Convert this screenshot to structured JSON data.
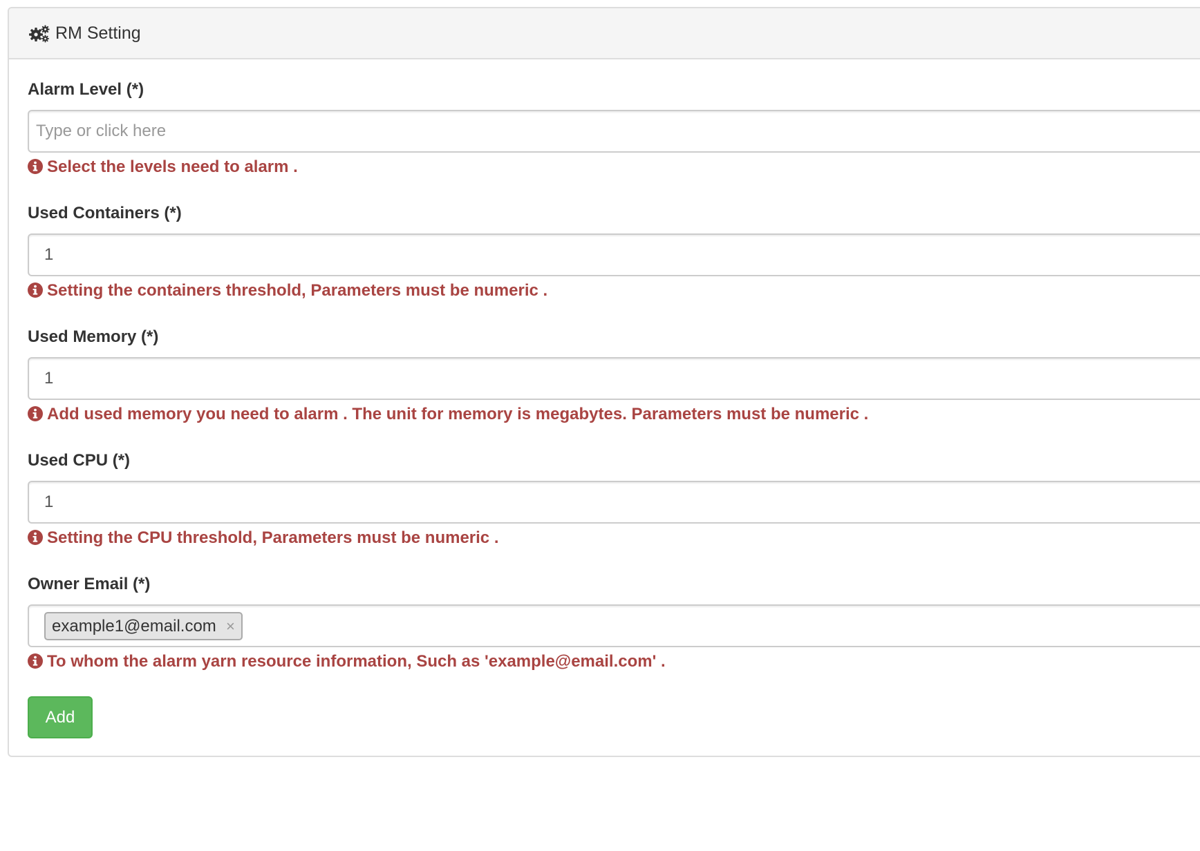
{
  "panel": {
    "title": "RM Setting",
    "icon": "gears-icon"
  },
  "fields": {
    "alarm_level": {
      "label": "Alarm Level (*)",
      "value": "",
      "placeholder": "Type or click here",
      "help": "Select the levels need to alarm ."
    },
    "used_containers": {
      "label": "Used Containers (*)",
      "value": "1",
      "placeholder": "",
      "help": "Setting the containers threshold, Parameters must be numeric ."
    },
    "used_memory": {
      "label": "Used Memory (*)",
      "value": "1",
      "placeholder": "",
      "help": "Add used memory you need to alarm . The unit for memory is megabytes. Parameters must be numeric ."
    },
    "used_cpu": {
      "label": "Used CPU (*)",
      "value": "1",
      "placeholder": "",
      "help": "Setting the CPU threshold, Parameters must be numeric ."
    },
    "owner_email": {
      "label": "Owner Email (*)",
      "tags": [
        "example1@email.com"
      ],
      "tag_remove": "×",
      "help": "To whom the alarm yarn resource information, Such as 'example@email.com' ."
    }
  },
  "actions": {
    "add_label": "Add"
  },
  "colors": {
    "error_text": "#a94442",
    "add_button": "#5cb85c",
    "panel_heading": "#f5f5f5",
    "border": "#dddddd"
  }
}
